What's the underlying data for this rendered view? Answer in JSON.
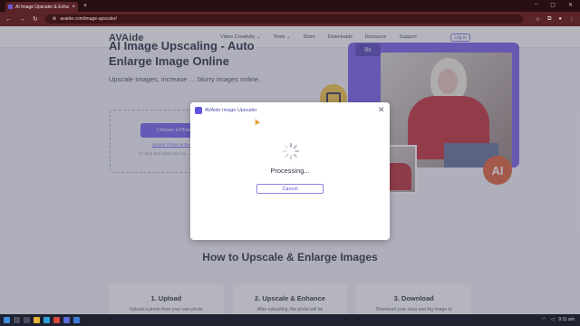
{
  "browser": {
    "tab_title": "AI Image Upscaler & Enha...",
    "tab_close": "×",
    "new_tab": "+",
    "url": "avaide.com/image-upscaler/",
    "window_controls": [
      "–",
      "▢",
      "✕"
    ]
  },
  "site": {
    "logo": "AVAide",
    "nav": [
      "Video Creativity ⌄",
      "Tools ⌄",
      "Store",
      "Downloads",
      "Resource",
      "Support"
    ],
    "login": "Log in"
  },
  "hero": {
    "title": "AI Image Upscaling - Auto Enlarge Image Online",
    "description": "Upscale Images, increase … blurry images online.",
    "choose_button": "Choose a Photo",
    "upload_link": "Upload Photos in Ba...",
    "drop_text": "Or drop and paste your im...",
    "zoom_badge": "8x",
    "ai_badge": "AI"
  },
  "how": {
    "title": "How to Upscale & Enlarge Images",
    "steps": [
      {
        "title": "1. Upload",
        "desc": "Upload a photo from your own photo"
      },
      {
        "title": "2. Upscale & Enhance",
        "desc": "After uploading, the photo will be"
      },
      {
        "title": "3. Download",
        "desc": "Download your clear and big image to"
      }
    ]
  },
  "modal": {
    "title": "AVAide Image Upscaler",
    "close": "✕",
    "status": "Processing...",
    "cancel": "Cancel"
  },
  "taskbar": {
    "time": "9:11 am",
    "date": "",
    "icons": [
      "start-icon",
      "search-icon",
      "task-view-icon",
      "file-explorer-icon",
      "edge-icon",
      "chrome-icon",
      "store-icon",
      "mail-icon"
    ]
  },
  "colors": {
    "accent": "#6a5cf0",
    "browser_frame": "#5a2429"
  }
}
